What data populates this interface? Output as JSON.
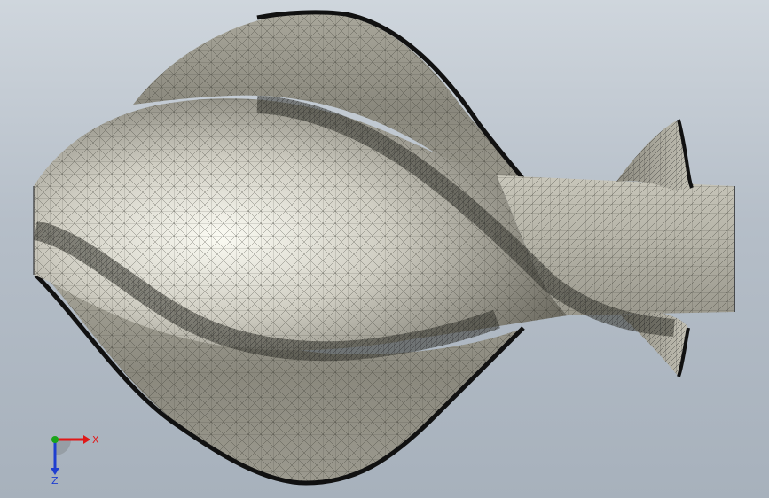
{
  "viewport": {
    "background_top": "#cfd6dd",
    "background_bottom": "#a7b1bc"
  },
  "model": {
    "icon": "meshed-propeller-part",
    "mesh_fill": "#8f8d82",
    "mesh_line": "#2b2b24",
    "highlight": "#f4f4ea"
  },
  "triad": {
    "x_label": "X",
    "z_label": "Z",
    "x_color": "#e01818",
    "y_color": "#1aa51a",
    "z_color": "#1f3fd0"
  }
}
